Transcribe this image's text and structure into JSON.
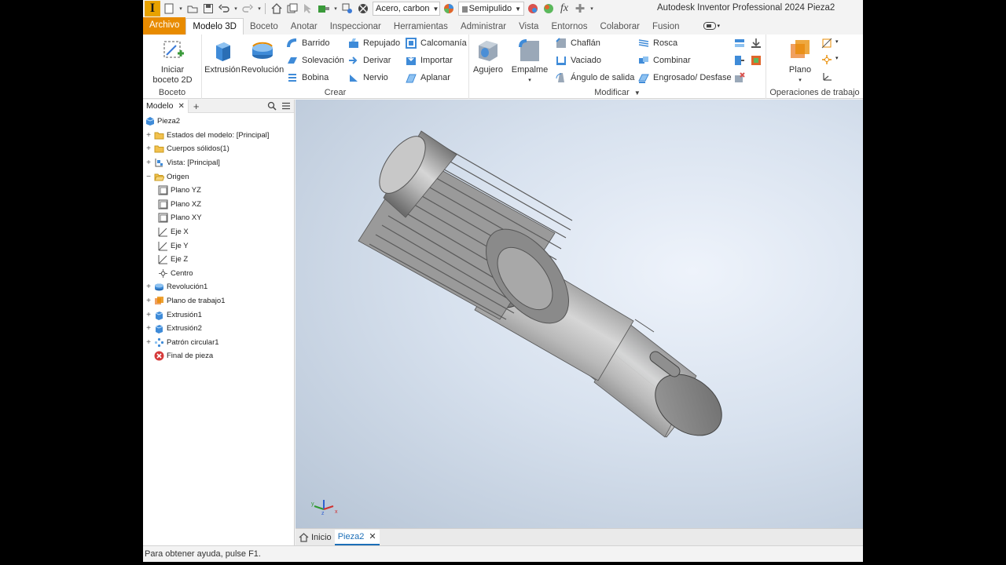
{
  "quick_access": {
    "app_logo_letter": "I",
    "material": "Acero, carbon",
    "appearance": "Semipulido",
    "icons": [
      "new-icon",
      "open-icon",
      "save-icon",
      "undo-icon",
      "redo-icon",
      "home-icon",
      "update-icon",
      "select-icon",
      "measure-icon",
      "material-icon",
      "appearance-icon",
      "fx-icon",
      "plus-icon"
    ]
  },
  "title": "Autodesk Inventor Professional 2024   Pieza2",
  "tabs": [
    {
      "label": "Archivo",
      "state": "file"
    },
    {
      "label": "Modelo 3D",
      "state": "active"
    },
    {
      "label": "Boceto"
    },
    {
      "label": "Anotar"
    },
    {
      "label": "Inspeccionar"
    },
    {
      "label": "Herramientas"
    },
    {
      "label": "Administrar"
    },
    {
      "label": "Vista"
    },
    {
      "label": "Entornos"
    },
    {
      "label": "Colaborar"
    },
    {
      "label": "Fusion"
    }
  ],
  "ribbon": {
    "boceto": {
      "title": "Boceto",
      "iniciar": "Iniciar\nboceto 2D"
    },
    "crear": {
      "title": "Crear",
      "extrusion": "Extrusión",
      "revolucion": "Revolución",
      "barrido": "Barrido",
      "solevacion": "Solevación",
      "bobina": "Bobina",
      "repujado": "Repujado",
      "derivar": "Derivar",
      "nervio": "Nervio",
      "calcomania": "Calcomanía",
      "importar": "Importar",
      "aplanar": "Aplanar"
    },
    "modificar": {
      "title": "Modificar",
      "agujero": "Agujero",
      "empalme": "Empalme",
      "chaflan": "Chaflán",
      "vaciado": "Vaciado",
      "angulo": "Ángulo de salida",
      "rosca": "Rosca",
      "combinar": "Combinar",
      "engrosado": "Engrosado/ Desfase"
    },
    "operaciones": {
      "title": "Operaciones de trabajo",
      "plano": "Plano"
    }
  },
  "browser": {
    "tab_label": "Modelo",
    "tree": [
      {
        "label": "Pieza2",
        "icon": "part-icon",
        "level": 0,
        "expander": ""
      },
      {
        "label": "Estados del modelo: [Principal]",
        "icon": "folder-icon",
        "level": 1,
        "expander": "+"
      },
      {
        "label": "Cuerpos sólidos(1)",
        "icon": "folder-icon",
        "level": 1,
        "expander": "+"
      },
      {
        "label": "Vista: [Principal]",
        "icon": "view-icon",
        "level": 1,
        "expander": "+"
      },
      {
        "label": "Origen",
        "icon": "folder-open-icon",
        "level": 1,
        "expander": "−"
      },
      {
        "label": "Plano YZ",
        "icon": "plane-icon",
        "level": 2,
        "expander": ""
      },
      {
        "label": "Plano XZ",
        "icon": "plane-icon",
        "level": 2,
        "expander": ""
      },
      {
        "label": "Plano XY",
        "icon": "plane-icon",
        "level": 2,
        "expander": ""
      },
      {
        "label": "Eje X",
        "icon": "axis-icon",
        "level": 2,
        "expander": ""
      },
      {
        "label": "Eje Y",
        "icon": "axis-icon",
        "level": 2,
        "expander": ""
      },
      {
        "label": "Eje Z",
        "icon": "axis-icon",
        "level": 2,
        "expander": ""
      },
      {
        "label": "Centro",
        "icon": "point-icon",
        "level": 2,
        "expander": ""
      },
      {
        "label": "Revolución1",
        "icon": "revolve-icon",
        "level": 1,
        "expander": "+"
      },
      {
        "label": "Plano de trabajo1",
        "icon": "workplane-icon",
        "level": 1,
        "expander": "+"
      },
      {
        "label": "Extrusión1",
        "icon": "extrude-icon",
        "level": 1,
        "expander": "+"
      },
      {
        "label": "Extrusión2",
        "icon": "extrude-icon",
        "level": 1,
        "expander": "+"
      },
      {
        "label": "Patrón circular1",
        "icon": "pattern-icon",
        "level": 1,
        "expander": "+"
      },
      {
        "label": "Final de pieza",
        "icon": "end-of-part-icon",
        "level": 1,
        "expander": ""
      }
    ]
  },
  "doc_tabs": {
    "home": "Inicio",
    "active": "Pieza2"
  },
  "status": "Para obtener ayuda, pulse F1.",
  "colors": {
    "accent": "#e88b00",
    "blue": "#1d6fb8",
    "folder": "#f2c14e"
  }
}
